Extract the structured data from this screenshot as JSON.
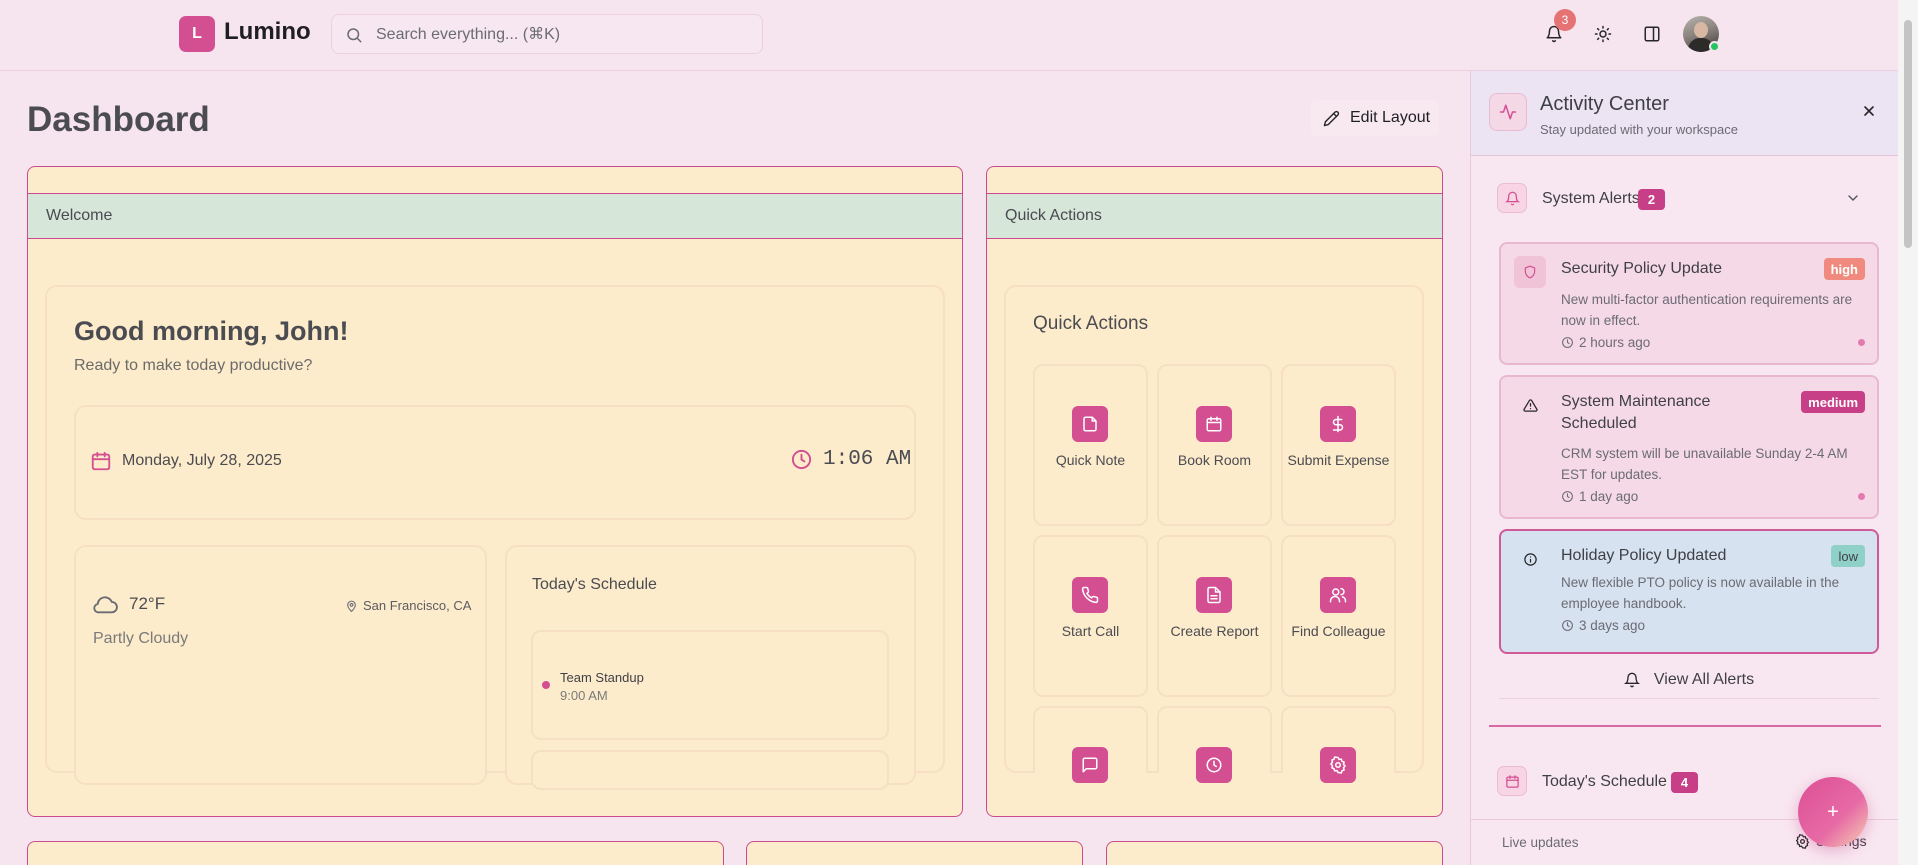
{
  "header": {
    "logo_letter": "L",
    "app_name": "Lumino",
    "search_placeholder": "Search everything... (⌘K)",
    "notification_count": "3"
  },
  "main": {
    "page_title": "Dashboard",
    "edit_layout_label": "Edit Layout",
    "welcome_widget": {
      "header": "Welcome",
      "greeting": "Good morning, John!",
      "subtitle": "Ready to make today productive?",
      "date": "Monday, July 28, 2025",
      "time": "1:06 AM",
      "weather": {
        "temperature": "72°F",
        "location": "San Francisco, CA",
        "condition": "Partly Cloudy"
      },
      "schedule": {
        "title": "Today's Schedule",
        "items": [
          {
            "name": "Team Standup",
            "time": "9:00 AM"
          }
        ]
      }
    },
    "quick_actions_widget": {
      "header": "Quick Actions",
      "title": "Quick Actions",
      "actions": [
        {
          "label": "Quick Note",
          "icon": "note-icon"
        },
        {
          "label": "Book Room",
          "icon": "calendar-icon"
        },
        {
          "label": "Submit Expense",
          "icon": "dollar-icon"
        },
        {
          "label": "Start Call",
          "icon": "phone-icon"
        },
        {
          "label": "Create Report",
          "icon": "document-icon"
        },
        {
          "label": "Find Colleague",
          "icon": "users-icon"
        },
        {
          "label": "",
          "icon": "message-icon"
        },
        {
          "label": "",
          "icon": "clock-icon"
        },
        {
          "label": "",
          "icon": "gear-icon"
        }
      ]
    }
  },
  "activity_panel": {
    "title": "Activity Center",
    "subtitle": "Stay updated with your workspace",
    "system_alerts": {
      "title": "System Alerts",
      "count": "2",
      "alerts": [
        {
          "title": "Security Policy Update",
          "severity": "high",
          "body": "New multi-factor authentication requirements are now in effect.",
          "time": "2 hours ago"
        },
        {
          "title": "System Maintenance Scheduled",
          "severity": "medium",
          "body": "CRM system will be unavailable Sunday 2-4 AM EST for updates.",
          "time": "1 day ago"
        },
        {
          "title": "Holiday Policy Updated",
          "severity": "low",
          "body": "New flexible PTO policy is now available in the employee handbook.",
          "time": "3 days ago"
        }
      ],
      "view_all_label": "View All Alerts"
    },
    "todays_schedule": {
      "title": "Today's Schedule",
      "count": "4"
    },
    "footer": {
      "live_label": "Live updates",
      "settings_label": "Settings"
    }
  },
  "fab": {
    "label": "+"
  },
  "colors": {
    "accent": "#d34f92",
    "background": "#f6e4ee",
    "widget_bg": "#fdeccb",
    "widget_header_bg": "#d6e6d8",
    "severity_high": "#f08a7e",
    "severity_medium": "#c73f87",
    "severity_low": "#8fd0c8"
  }
}
